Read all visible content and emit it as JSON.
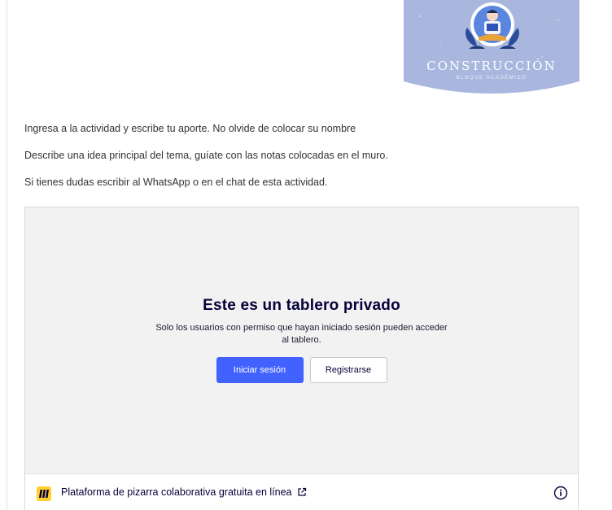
{
  "banner": {
    "title": "CONSTRUCCIÓN",
    "subtitle": "BLOQUE ACADÉMICO",
    "icon": "person-with-laptop-icon"
  },
  "instructions": [
    "Ingresa a la actividad y escribe tu aporte. No olvide de colocar su nombre",
    "Describe una idea principal del tema, guíate con las notas colocadas en el muro.",
    "Si tienes dudas escribir al WhatsApp o en el chat de esta actividad."
  ],
  "board": {
    "title": "Este es un tablero privado",
    "description": "Solo los usuarios con permiso que hayan iniciado sesión pueden acceder al tablero.",
    "login_label": "Iniciar sesión",
    "register_label": "Registrarse",
    "footer_link": "Plataforma de pizarra colaborativa gratuita en línea",
    "footer_icons": [
      "miro-logo-icon",
      "external-link-icon",
      "info-icon"
    ]
  },
  "colors": {
    "primary_button": "#4262ff",
    "board_background": "#f2f2f2",
    "banner_background": "#a4b3db",
    "logo_yellow": "#ffd02f"
  }
}
